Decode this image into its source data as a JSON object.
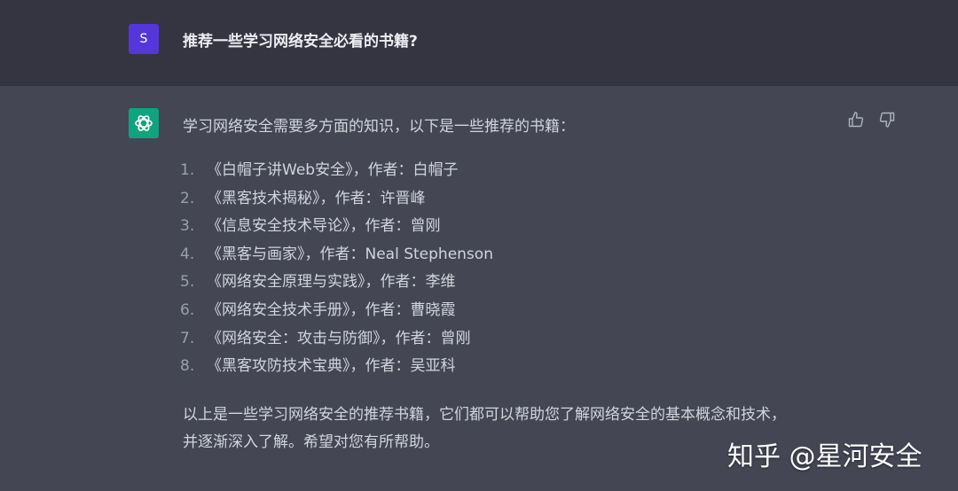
{
  "user_message": {
    "avatar_letter": "S",
    "text": "推荐一些学习网络安全必看的书籍?"
  },
  "assistant_message": {
    "intro": "学习网络安全需要多方面的知识，以下是一些推荐的书籍：",
    "books": [
      {
        "num": "1.",
        "text": "《白帽子讲Web安全》，作者：白帽子"
      },
      {
        "num": "2.",
        "text": "《黑客技术揭秘》，作者：许晋峰"
      },
      {
        "num": "3.",
        "text": "《信息安全技术导论》，作者：曾刚"
      },
      {
        "num": "4.",
        "text": "《黑客与画家》，作者：Neal Stephenson"
      },
      {
        "num": "5.",
        "text": "《网络安全原理与实践》，作者：李维"
      },
      {
        "num": "6.",
        "text": "《网络安全技术手册》，作者：曹晓霞"
      },
      {
        "num": "7.",
        "text": "《网络安全：攻击与防御》，作者：曾刚"
      },
      {
        "num": "8.",
        "text": "《黑客攻防技术宝典》，作者：吴亚科"
      }
    ],
    "outro_line1": "以上是一些学习网络安全的推荐书籍，它们都可以帮助您了解网络安全的基本概念和技术，",
    "outro_line2": "并逐渐深入了解。希望对您有所帮助。"
  },
  "icons": {
    "bot_avatar": "openai-logo-icon",
    "like": "thumbs-up-icon",
    "dislike": "thumbs-down-icon"
  },
  "watermark": "知乎 @星河安全",
  "colors": {
    "user_bg": "#343541",
    "assistant_bg": "#444654",
    "user_avatar": "#5436da",
    "bot_avatar": "#10a37f"
  }
}
